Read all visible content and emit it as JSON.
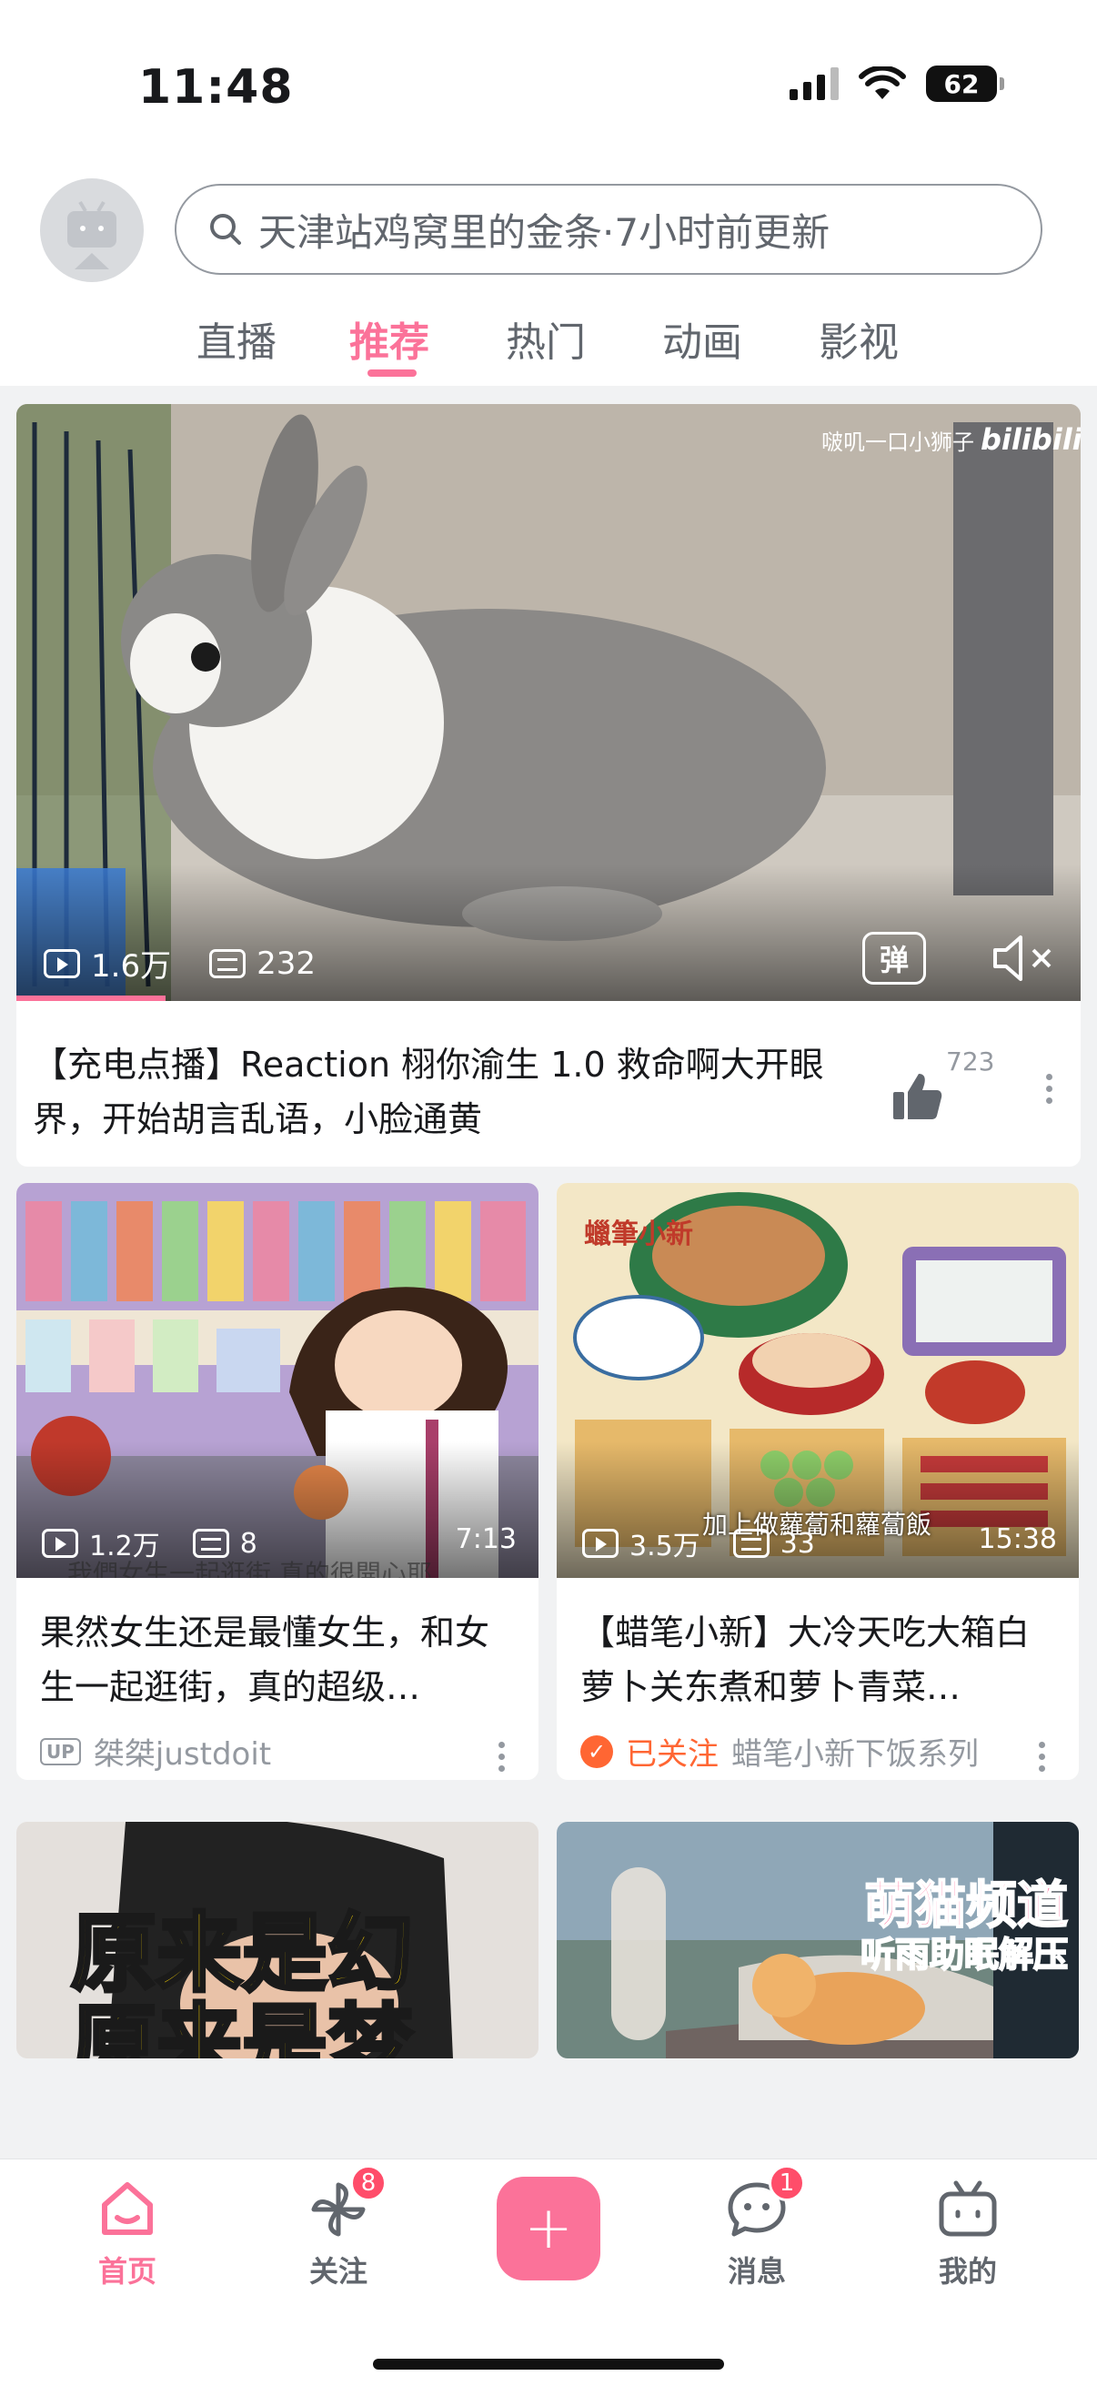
{
  "status": {
    "time": "11:48",
    "battery": "62"
  },
  "search": {
    "placeholder": "天津站鸡窝里的金条·7小时前更新"
  },
  "tabs": [
    {
      "label": "直播",
      "active": false
    },
    {
      "label": "推荐",
      "active": true
    },
    {
      "label": "热门",
      "active": false
    },
    {
      "label": "动画",
      "active": false
    },
    {
      "label": "影视",
      "active": false
    }
  ],
  "featured": {
    "watermark": "啵叽一口小狮子",
    "brand": "bilibili",
    "views": "1.6万",
    "danmaku": "232",
    "danmaku_toggle": "弹",
    "title": "【充电点播】Reaction 栩你渝生 1.0 救命啊大开眼界，开始胡言乱语，小脸通黄",
    "likes": "723",
    "progress_fraction": 0.14
  },
  "cards": [
    {
      "views": "1.2万",
      "danmaku": "8",
      "duration": "7:13",
      "title": "果然女生还是最懂女生，和女生一起逛街，真的超级…",
      "author_badge": "UP",
      "author": "桀桀justdoit",
      "followed_label": "",
      "thumb_caption": "我們女生一起逛街 真的很開心耶"
    },
    {
      "views": "3.5万",
      "danmaku": "33",
      "duration": "15:38",
      "title": "【蜡笔小新】大冷天吃大箱白萝卜关东煮和萝卜青菜…",
      "author_badge": "",
      "author": "蜡笔小新下饭系列",
      "followed_label": "已关注",
      "thumb_caption": "加上做蘿蔔和蘿蔔飯",
      "thumb_logo": "蠟筆小新"
    },
    {
      "thumb_text_line1": "原来是幻",
      "thumb_text_line2": "原来是梦"
    },
    {
      "thumb_text_line1": "萌猫频道",
      "thumb_text_line2": "听雨助眠解压"
    }
  ],
  "bottom_nav": [
    {
      "label": "首页",
      "icon": "home-icon",
      "badge": ""
    },
    {
      "label": "关注",
      "icon": "pinwheel-icon",
      "badge": "8"
    },
    {
      "label": "消息",
      "icon": "message-icon",
      "badge": "1"
    },
    {
      "label": "我的",
      "icon": "tv-icon",
      "badge": ""
    }
  ],
  "colors": {
    "accent": "#fb7299",
    "followed": "#ff6633",
    "badge": "#ff4d6a"
  }
}
